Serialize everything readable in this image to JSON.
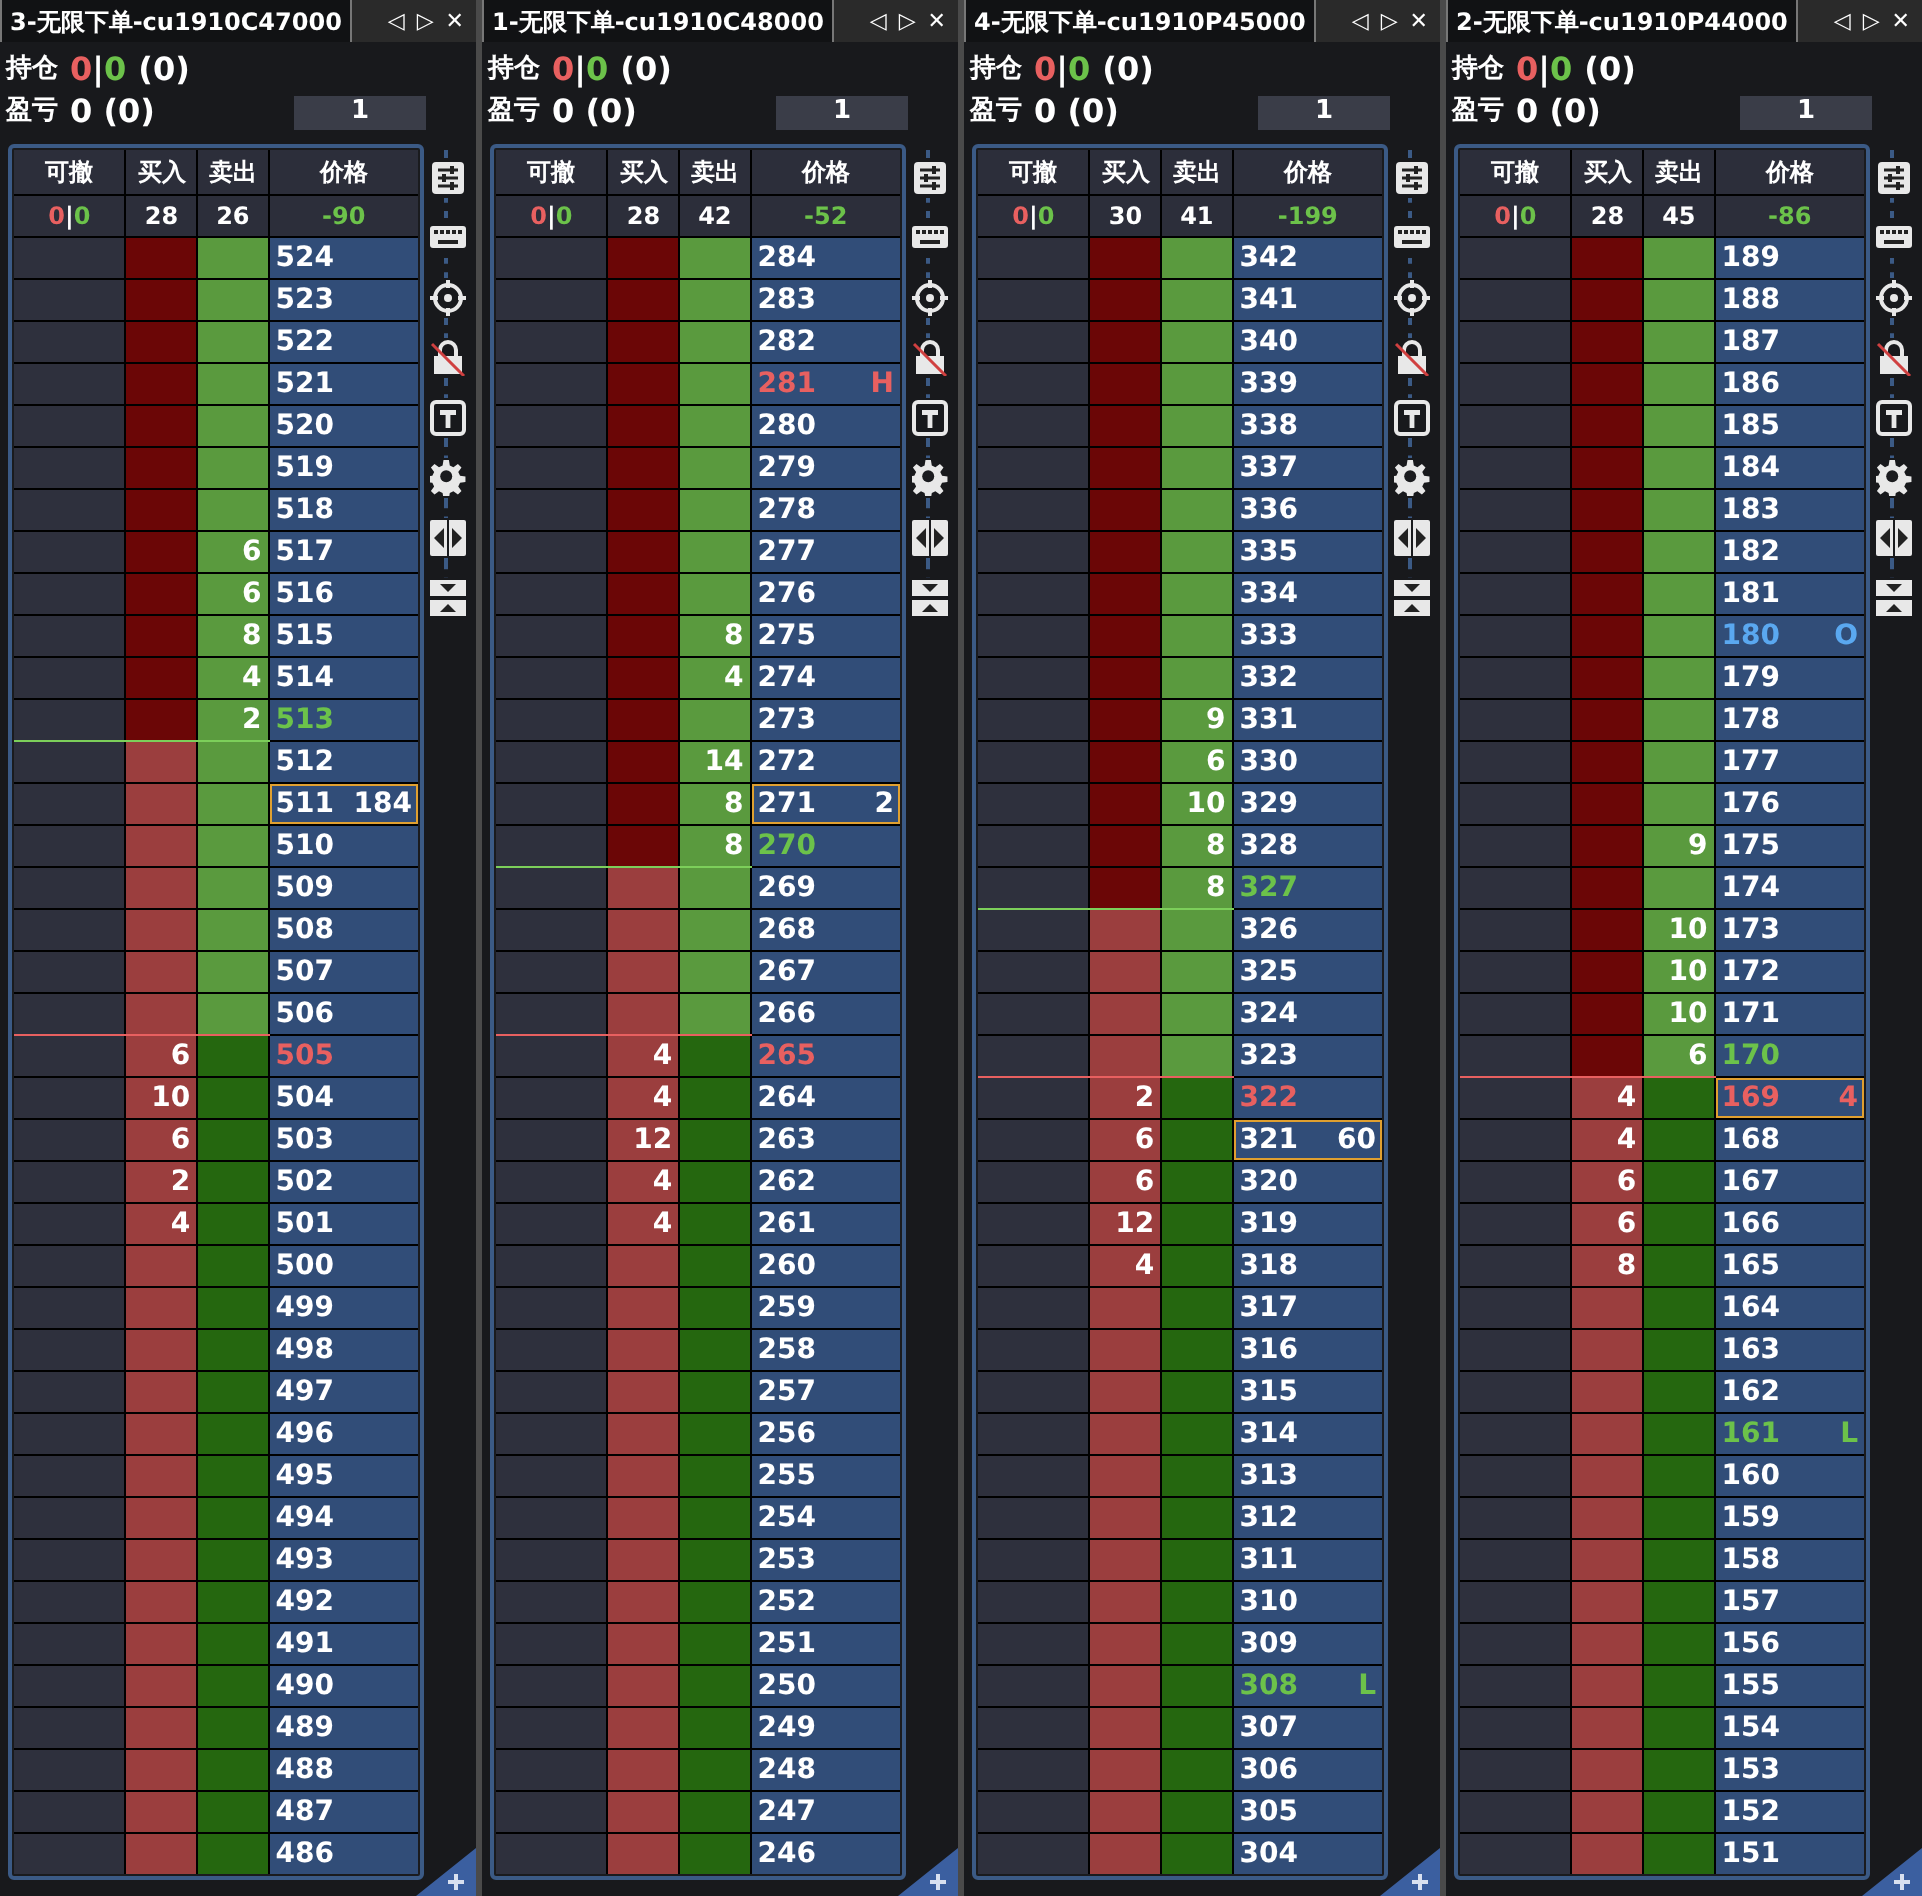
{
  "panels": [
    {
      "title": "3-无限下单-cu1910C47000",
      "position": {
        "label": "持仓",
        "long": "0",
        "separator": "|",
        "short": "0",
        "total": "(0)"
      },
      "pnl": {
        "label": "盈亏",
        "value": "0 (0)"
      },
      "quantity": "1",
      "columns": [
        "可撤",
        "买入",
        "卖出",
        "价格"
      ],
      "summary": {
        "cancel_long": "0",
        "cancel_sep": "|",
        "cancel_short": "0",
        "buy": "28",
        "sell": "26",
        "price": "-90"
      },
      "rows": [
        {
          "price": "524",
          "buy_dark": true,
          "sell_dark": false,
          "kind": "plain",
          "focused": false
        },
        {
          "price": "523",
          "buy_dark": true,
          "sell_dark": false,
          "kind": "plain",
          "focused": false
        },
        {
          "price": "522",
          "buy_dark": true,
          "sell_dark": false,
          "kind": "plain",
          "focused": false
        },
        {
          "price": "521",
          "buy_dark": true,
          "sell_dark": false,
          "kind": "plain",
          "focused": false
        },
        {
          "price": "520",
          "buy_dark": true,
          "sell_dark": false,
          "kind": "plain",
          "focused": false
        },
        {
          "price": "519",
          "buy_dark": true,
          "sell_dark": false,
          "kind": "plain",
          "focused": false
        },
        {
          "price": "518",
          "buy_dark": true,
          "sell_dark": false,
          "kind": "plain",
          "focused": false
        },
        {
          "price": "517",
          "sell": "6",
          "buy_dark": true,
          "sell_dark": false,
          "kind": "plain",
          "focused": false
        },
        {
          "price": "516",
          "sell": "6",
          "buy_dark": true,
          "sell_dark": false,
          "kind": "plain",
          "focused": false
        },
        {
          "price": "515",
          "sell": "8",
          "buy_dark": true,
          "sell_dark": false,
          "kind": "plain",
          "focused": false
        },
        {
          "price": "514",
          "sell": "4",
          "buy_dark": true,
          "sell_dark": false,
          "kind": "plain",
          "focused": false
        },
        {
          "price": "513",
          "sell": "2",
          "buy_dark": true,
          "sell_dark": false,
          "kind": "ask",
          "focused": false
        },
        {
          "price": "512",
          "buy_dark": false,
          "sell_dark": false,
          "kind": "plain",
          "focused": false
        },
        {
          "price": "511",
          "marker": "184",
          "buy_dark": false,
          "sell_dark": false,
          "kind": "plain",
          "focused": true
        },
        {
          "price": "510",
          "buy_dark": false,
          "sell_dark": false,
          "kind": "plain",
          "focused": false
        },
        {
          "price": "509",
          "buy_dark": false,
          "sell_dark": false,
          "kind": "plain",
          "focused": false
        },
        {
          "price": "508",
          "buy_dark": false,
          "sell_dark": false,
          "kind": "plain",
          "focused": false
        },
        {
          "price": "507",
          "buy_dark": false,
          "sell_dark": false,
          "kind": "plain",
          "focused": false
        },
        {
          "price": "506",
          "buy_dark": false,
          "sell_dark": false,
          "kind": "plain",
          "focused": false
        },
        {
          "price": "505",
          "buy": "6",
          "buy_dark": false,
          "sell_dark": true,
          "kind": "bid",
          "focused": false
        },
        {
          "price": "504",
          "buy": "10",
          "buy_dark": false,
          "sell_dark": true,
          "kind": "plain",
          "focused": false
        },
        {
          "price": "503",
          "buy": "6",
          "buy_dark": false,
          "sell_dark": true,
          "kind": "plain",
          "focused": false
        },
        {
          "price": "502",
          "buy": "2",
          "buy_dark": false,
          "sell_dark": true,
          "kind": "plain",
          "focused": false
        },
        {
          "price": "501",
          "buy": "4",
          "buy_dark": false,
          "sell_dark": true,
          "kind": "plain",
          "focused": false
        },
        {
          "price": "500",
          "buy_dark": false,
          "sell_dark": true,
          "kind": "plain",
          "focused": false
        },
        {
          "price": "499",
          "buy_dark": false,
          "sell_dark": true,
          "kind": "plain",
          "focused": false
        },
        {
          "price": "498",
          "buy_dark": false,
          "sell_dark": true,
          "kind": "plain",
          "focused": false
        },
        {
          "price": "497",
          "buy_dark": false,
          "sell_dark": true,
          "kind": "plain",
          "focused": false
        },
        {
          "price": "496",
          "buy_dark": false,
          "sell_dark": true,
          "kind": "plain",
          "focused": false
        },
        {
          "price": "495",
          "buy_dark": false,
          "sell_dark": true,
          "kind": "plain",
          "focused": false
        },
        {
          "price": "494",
          "buy_dark": false,
          "sell_dark": true,
          "kind": "plain",
          "focused": false
        },
        {
          "price": "493",
          "buy_dark": false,
          "sell_dark": true,
          "kind": "plain",
          "focused": false
        },
        {
          "price": "492",
          "buy_dark": false,
          "sell_dark": true,
          "kind": "plain",
          "focused": false
        },
        {
          "price": "491",
          "buy_dark": false,
          "sell_dark": true,
          "kind": "plain",
          "focused": false
        },
        {
          "price": "490",
          "buy_dark": false,
          "sell_dark": true,
          "kind": "plain",
          "focused": false
        },
        {
          "price": "489",
          "buy_dark": false,
          "sell_dark": true,
          "kind": "plain",
          "focused": false
        },
        {
          "price": "488",
          "buy_dark": false,
          "sell_dark": true,
          "kind": "plain",
          "focused": false
        },
        {
          "price": "487",
          "buy_dark": false,
          "sell_dark": true,
          "kind": "plain",
          "focused": false
        },
        {
          "price": "486",
          "buy_dark": false,
          "sell_dark": true,
          "kind": "plain",
          "focused": false
        }
      ]
    },
    {
      "title": "1-无限下单-cu1910C48000",
      "position": {
        "label": "持仓",
        "long": "0",
        "separator": "|",
        "short": "0",
        "total": "(0)"
      },
      "pnl": {
        "label": "盈亏",
        "value": "0 (0)"
      },
      "quantity": "1",
      "columns": [
        "可撤",
        "买入",
        "卖出",
        "价格"
      ],
      "summary": {
        "cancel_long": "0",
        "cancel_sep": "|",
        "cancel_short": "0",
        "buy": "28",
        "sell": "42",
        "price": "-52"
      },
      "rows": [
        {
          "price": "284",
          "buy_dark": true,
          "sell_dark": false,
          "kind": "plain",
          "focused": false
        },
        {
          "price": "283",
          "buy_dark": true,
          "sell_dark": false,
          "kind": "plain",
          "focused": false
        },
        {
          "price": "282",
          "buy_dark": true,
          "sell_dark": false,
          "kind": "plain",
          "focused": false
        },
        {
          "price": "281",
          "marker": "H",
          "buy_dark": true,
          "sell_dark": false,
          "kind": "high",
          "focused": false
        },
        {
          "price": "280",
          "buy_dark": true,
          "sell_dark": false,
          "kind": "plain",
          "focused": false
        },
        {
          "price": "279",
          "buy_dark": true,
          "sell_dark": false,
          "kind": "plain",
          "focused": false
        },
        {
          "price": "278",
          "buy_dark": true,
          "sell_dark": false,
          "kind": "plain",
          "focused": false
        },
        {
          "price": "277",
          "buy_dark": true,
          "sell_dark": false,
          "kind": "plain",
          "focused": false
        },
        {
          "price": "276",
          "buy_dark": true,
          "sell_dark": false,
          "kind": "plain",
          "focused": false
        },
        {
          "price": "275",
          "sell": "8",
          "buy_dark": true,
          "sell_dark": false,
          "kind": "plain",
          "focused": false
        },
        {
          "price": "274",
          "sell": "4",
          "buy_dark": true,
          "sell_dark": false,
          "kind": "plain",
          "focused": false
        },
        {
          "price": "273",
          "buy_dark": true,
          "sell_dark": false,
          "kind": "plain",
          "focused": false
        },
        {
          "price": "272",
          "sell": "14",
          "buy_dark": true,
          "sell_dark": false,
          "kind": "plain",
          "focused": false
        },
        {
          "price": "271",
          "sell": "8",
          "marker": "2",
          "buy_dark": true,
          "sell_dark": false,
          "kind": "plain",
          "focused": true
        },
        {
          "price": "270",
          "sell": "8",
          "buy_dark": true,
          "sell_dark": false,
          "kind": "ask",
          "focused": false
        },
        {
          "price": "269",
          "buy_dark": false,
          "sell_dark": false,
          "kind": "plain",
          "focused": false
        },
        {
          "price": "268",
          "buy_dark": false,
          "sell_dark": false,
          "kind": "plain",
          "focused": false
        },
        {
          "price": "267",
          "buy_dark": false,
          "sell_dark": false,
          "kind": "plain",
          "focused": false
        },
        {
          "price": "266",
          "buy_dark": false,
          "sell_dark": false,
          "kind": "plain",
          "focused": false
        },
        {
          "price": "265",
          "buy": "4",
          "buy_dark": false,
          "sell_dark": true,
          "kind": "bid",
          "focused": false
        },
        {
          "price": "264",
          "buy": "4",
          "buy_dark": false,
          "sell_dark": true,
          "kind": "plain",
          "focused": false
        },
        {
          "price": "263",
          "buy": "12",
          "buy_dark": false,
          "sell_dark": true,
          "kind": "plain",
          "focused": false
        },
        {
          "price": "262",
          "buy": "4",
          "buy_dark": false,
          "sell_dark": true,
          "kind": "plain",
          "focused": false
        },
        {
          "price": "261",
          "buy": "4",
          "buy_dark": false,
          "sell_dark": true,
          "kind": "plain",
          "focused": false
        },
        {
          "price": "260",
          "buy_dark": false,
          "sell_dark": true,
          "kind": "plain",
          "focused": false
        },
        {
          "price": "259",
          "buy_dark": false,
          "sell_dark": true,
          "kind": "plain",
          "focused": false
        },
        {
          "price": "258",
          "buy_dark": false,
          "sell_dark": true,
          "kind": "plain",
          "focused": false
        },
        {
          "price": "257",
          "buy_dark": false,
          "sell_dark": true,
          "kind": "plain",
          "focused": false
        },
        {
          "price": "256",
          "buy_dark": false,
          "sell_dark": true,
          "kind": "plain",
          "focused": false
        },
        {
          "price": "255",
          "buy_dark": false,
          "sell_dark": true,
          "kind": "plain",
          "focused": false
        },
        {
          "price": "254",
          "buy_dark": false,
          "sell_dark": true,
          "kind": "plain",
          "focused": false
        },
        {
          "price": "253",
          "buy_dark": false,
          "sell_dark": true,
          "kind": "plain",
          "focused": false
        },
        {
          "price": "252",
          "buy_dark": false,
          "sell_dark": true,
          "kind": "plain",
          "focused": false
        },
        {
          "price": "251",
          "buy_dark": false,
          "sell_dark": true,
          "kind": "plain",
          "focused": false
        },
        {
          "price": "250",
          "buy_dark": false,
          "sell_dark": true,
          "kind": "plain",
          "focused": false
        },
        {
          "price": "249",
          "buy_dark": false,
          "sell_dark": true,
          "kind": "plain",
          "focused": false
        },
        {
          "price": "248",
          "buy_dark": false,
          "sell_dark": true,
          "kind": "plain",
          "focused": false
        },
        {
          "price": "247",
          "buy_dark": false,
          "sell_dark": true,
          "kind": "plain",
          "focused": false
        },
        {
          "price": "246",
          "buy_dark": false,
          "sell_dark": true,
          "kind": "plain",
          "focused": false
        }
      ]
    },
    {
      "title": "4-无限下单-cu1910P45000",
      "position": {
        "label": "持仓",
        "long": "0",
        "separator": "|",
        "short": "0",
        "total": "(0)"
      },
      "pnl": {
        "label": "盈亏",
        "value": "0 (0)"
      },
      "quantity": "1",
      "columns": [
        "可撤",
        "买入",
        "卖出",
        "价格"
      ],
      "summary": {
        "cancel_long": "0",
        "cancel_sep": "|",
        "cancel_short": "0",
        "buy": "30",
        "sell": "41",
        "price": "-199"
      },
      "rows": [
        {
          "price": "342",
          "buy_dark": true,
          "sell_dark": false,
          "kind": "plain",
          "focused": false
        },
        {
          "price": "341",
          "buy_dark": true,
          "sell_dark": false,
          "kind": "plain",
          "focused": false
        },
        {
          "price": "340",
          "buy_dark": true,
          "sell_dark": false,
          "kind": "plain",
          "focused": false
        },
        {
          "price": "339",
          "buy_dark": true,
          "sell_dark": false,
          "kind": "plain",
          "focused": false
        },
        {
          "price": "338",
          "buy_dark": true,
          "sell_dark": false,
          "kind": "plain",
          "focused": false
        },
        {
          "price": "337",
          "buy_dark": true,
          "sell_dark": false,
          "kind": "plain",
          "focused": false
        },
        {
          "price": "336",
          "buy_dark": true,
          "sell_dark": false,
          "kind": "plain",
          "focused": false
        },
        {
          "price": "335",
          "buy_dark": true,
          "sell_dark": false,
          "kind": "plain",
          "focused": false
        },
        {
          "price": "334",
          "buy_dark": true,
          "sell_dark": false,
          "kind": "plain",
          "focused": false
        },
        {
          "price": "333",
          "buy_dark": true,
          "sell_dark": false,
          "kind": "plain",
          "focused": false
        },
        {
          "price": "332",
          "buy_dark": true,
          "sell_dark": false,
          "kind": "plain",
          "focused": false
        },
        {
          "price": "331",
          "sell": "9",
          "buy_dark": true,
          "sell_dark": false,
          "kind": "plain",
          "focused": false
        },
        {
          "price": "330",
          "sell": "6",
          "buy_dark": true,
          "sell_dark": false,
          "kind": "plain",
          "focused": false
        },
        {
          "price": "329",
          "sell": "10",
          "buy_dark": true,
          "sell_dark": false,
          "kind": "plain",
          "focused": false
        },
        {
          "price": "328",
          "sell": "8",
          "buy_dark": true,
          "sell_dark": false,
          "kind": "plain",
          "focused": false
        },
        {
          "price": "327",
          "sell": "8",
          "buy_dark": true,
          "sell_dark": false,
          "kind": "ask",
          "focused": false
        },
        {
          "price": "326",
          "buy_dark": false,
          "sell_dark": false,
          "kind": "plain",
          "focused": false
        },
        {
          "price": "325",
          "buy_dark": false,
          "sell_dark": false,
          "kind": "plain",
          "focused": false
        },
        {
          "price": "324",
          "buy_dark": false,
          "sell_dark": false,
          "kind": "plain",
          "focused": false
        },
        {
          "price": "323",
          "buy_dark": false,
          "sell_dark": false,
          "kind": "plain",
          "focused": false
        },
        {
          "price": "322",
          "buy": "2",
          "buy_dark": false,
          "sell_dark": true,
          "kind": "bid",
          "focused": false
        },
        {
          "price": "321",
          "buy": "6",
          "marker": "60",
          "buy_dark": false,
          "sell_dark": true,
          "kind": "plain",
          "focused": true
        },
        {
          "price": "320",
          "buy": "6",
          "buy_dark": false,
          "sell_dark": true,
          "kind": "plain",
          "focused": false
        },
        {
          "price": "319",
          "buy": "12",
          "buy_dark": false,
          "sell_dark": true,
          "kind": "plain",
          "focused": false
        },
        {
          "price": "318",
          "buy": "4",
          "buy_dark": false,
          "sell_dark": true,
          "kind": "plain",
          "focused": false
        },
        {
          "price": "317",
          "buy_dark": false,
          "sell_dark": true,
          "kind": "plain",
          "focused": false
        },
        {
          "price": "316",
          "buy_dark": false,
          "sell_dark": true,
          "kind": "plain",
          "focused": false
        },
        {
          "price": "315",
          "buy_dark": false,
          "sell_dark": true,
          "kind": "plain",
          "focused": false
        },
        {
          "price": "314",
          "buy_dark": false,
          "sell_dark": true,
          "kind": "plain",
          "focused": false
        },
        {
          "price": "313",
          "buy_dark": false,
          "sell_dark": true,
          "kind": "plain",
          "focused": false
        },
        {
          "price": "312",
          "buy_dark": false,
          "sell_dark": true,
          "kind": "plain",
          "focused": false
        },
        {
          "price": "311",
          "buy_dark": false,
          "sell_dark": true,
          "kind": "plain",
          "focused": false
        },
        {
          "price": "310",
          "buy_dark": false,
          "sell_dark": true,
          "kind": "plain",
          "focused": false
        },
        {
          "price": "309",
          "buy_dark": false,
          "sell_dark": true,
          "kind": "plain",
          "focused": false
        },
        {
          "price": "308",
          "marker": "L",
          "buy_dark": false,
          "sell_dark": true,
          "kind": "low",
          "focused": false
        },
        {
          "price": "307",
          "buy_dark": false,
          "sell_dark": true,
          "kind": "plain",
          "focused": false
        },
        {
          "price": "306",
          "buy_dark": false,
          "sell_dark": true,
          "kind": "plain",
          "focused": false
        },
        {
          "price": "305",
          "buy_dark": false,
          "sell_dark": true,
          "kind": "plain",
          "focused": false
        },
        {
          "price": "304",
          "buy_dark": false,
          "sell_dark": true,
          "kind": "plain",
          "focused": false
        }
      ]
    },
    {
      "title": "2-无限下单-cu1910P44000",
      "position": {
        "label": "持仓",
        "long": "0",
        "separator": "|",
        "short": "0",
        "total": "(0)"
      },
      "pnl": {
        "label": "盈亏",
        "value": "0 (0)"
      },
      "quantity": "1",
      "columns": [
        "可撤",
        "买入",
        "卖出",
        "价格"
      ],
      "summary": {
        "cancel_long": "0",
        "cancel_sep": "|",
        "cancel_short": "0",
        "buy": "28",
        "sell": "45",
        "price": "-86"
      },
      "rows": [
        {
          "price": "189",
          "buy_dark": true,
          "sell_dark": false,
          "kind": "plain",
          "focused": false
        },
        {
          "price": "188",
          "buy_dark": true,
          "sell_dark": false,
          "kind": "plain",
          "focused": false
        },
        {
          "price": "187",
          "buy_dark": true,
          "sell_dark": false,
          "kind": "plain",
          "focused": false
        },
        {
          "price": "186",
          "buy_dark": true,
          "sell_dark": false,
          "kind": "plain",
          "focused": false
        },
        {
          "price": "185",
          "buy_dark": true,
          "sell_dark": false,
          "kind": "plain",
          "focused": false
        },
        {
          "price": "184",
          "buy_dark": true,
          "sell_dark": false,
          "kind": "plain",
          "focused": false
        },
        {
          "price": "183",
          "buy_dark": true,
          "sell_dark": false,
          "kind": "plain",
          "focused": false
        },
        {
          "price": "182",
          "buy_dark": true,
          "sell_dark": false,
          "kind": "plain",
          "focused": false
        },
        {
          "price": "181",
          "buy_dark": true,
          "sell_dark": false,
          "kind": "plain",
          "focused": false
        },
        {
          "price": "180",
          "marker": "O",
          "buy_dark": true,
          "sell_dark": false,
          "kind": "order",
          "focused": false
        },
        {
          "price": "179",
          "buy_dark": true,
          "sell_dark": false,
          "kind": "plain",
          "focused": false
        },
        {
          "price": "178",
          "buy_dark": true,
          "sell_dark": false,
          "kind": "plain",
          "focused": false
        },
        {
          "price": "177",
          "buy_dark": true,
          "sell_dark": false,
          "kind": "plain",
          "focused": false
        },
        {
          "price": "176",
          "buy_dark": true,
          "sell_dark": false,
          "kind": "plain",
          "focused": false
        },
        {
          "price": "175",
          "sell": "9",
          "buy_dark": true,
          "sell_dark": false,
          "kind": "plain",
          "focused": false
        },
        {
          "price": "174",
          "buy_dark": true,
          "sell_dark": false,
          "kind": "plain",
          "focused": false
        },
        {
          "price": "173",
          "sell": "10",
          "buy_dark": true,
          "sell_dark": false,
          "kind": "plain",
          "focused": false
        },
        {
          "price": "172",
          "sell": "10",
          "buy_dark": true,
          "sell_dark": false,
          "kind": "plain",
          "focused": false
        },
        {
          "price": "171",
          "sell": "10",
          "buy_dark": true,
          "sell_dark": false,
          "kind": "plain",
          "focused": false
        },
        {
          "price": "170",
          "sell": "6",
          "buy_dark": true,
          "sell_dark": false,
          "kind": "ask",
          "focused": false
        },
        {
          "price": "169",
          "buy": "4",
          "marker": "4",
          "buy_dark": false,
          "sell_dark": true,
          "kind": "bid",
          "focused": true
        },
        {
          "price": "168",
          "buy": "4",
          "buy_dark": false,
          "sell_dark": true,
          "kind": "plain",
          "focused": false
        },
        {
          "price": "167",
          "buy": "6",
          "buy_dark": false,
          "sell_dark": true,
          "kind": "plain",
          "focused": false
        },
        {
          "price": "166",
          "buy": "6",
          "buy_dark": false,
          "sell_dark": true,
          "kind": "plain",
          "focused": false
        },
        {
          "price": "165",
          "buy": "8",
          "buy_dark": false,
          "sell_dark": true,
          "kind": "plain",
          "focused": false
        },
        {
          "price": "164",
          "buy_dark": false,
          "sell_dark": true,
          "kind": "plain",
          "focused": false
        },
        {
          "price": "163",
          "buy_dark": false,
          "sell_dark": true,
          "kind": "plain",
          "focused": false
        },
        {
          "price": "162",
          "buy_dark": false,
          "sell_dark": true,
          "kind": "plain",
          "focused": false
        },
        {
          "price": "161",
          "marker": "L",
          "buy_dark": false,
          "sell_dark": true,
          "kind": "low",
          "focused": false
        },
        {
          "price": "160",
          "buy_dark": false,
          "sell_dark": true,
          "kind": "plain",
          "focused": false
        },
        {
          "price": "159",
          "buy_dark": false,
          "sell_dark": true,
          "kind": "plain",
          "focused": false
        },
        {
          "price": "158",
          "buy_dark": false,
          "sell_dark": true,
          "kind": "plain",
          "focused": false
        },
        {
          "price": "157",
          "buy_dark": false,
          "sell_dark": true,
          "kind": "plain",
          "focused": false
        },
        {
          "price": "156",
          "buy_dark": false,
          "sell_dark": true,
          "kind": "plain",
          "focused": false
        },
        {
          "price": "155",
          "buy_dark": false,
          "sell_dark": true,
          "kind": "plain",
          "focused": false
        },
        {
          "price": "154",
          "buy_dark": false,
          "sell_dark": true,
          "kind": "plain",
          "focused": false
        },
        {
          "price": "153",
          "buy_dark": false,
          "sell_dark": true,
          "kind": "plain",
          "focused": false
        },
        {
          "price": "152",
          "buy_dark": false,
          "sell_dark": true,
          "kind": "plain",
          "focused": false
        },
        {
          "price": "151",
          "buy_dark": false,
          "sell_dark": true,
          "kind": "plain",
          "focused": false
        }
      ]
    }
  ],
  "tab_controls": [
    "◁",
    "▷",
    "✕"
  ]
}
